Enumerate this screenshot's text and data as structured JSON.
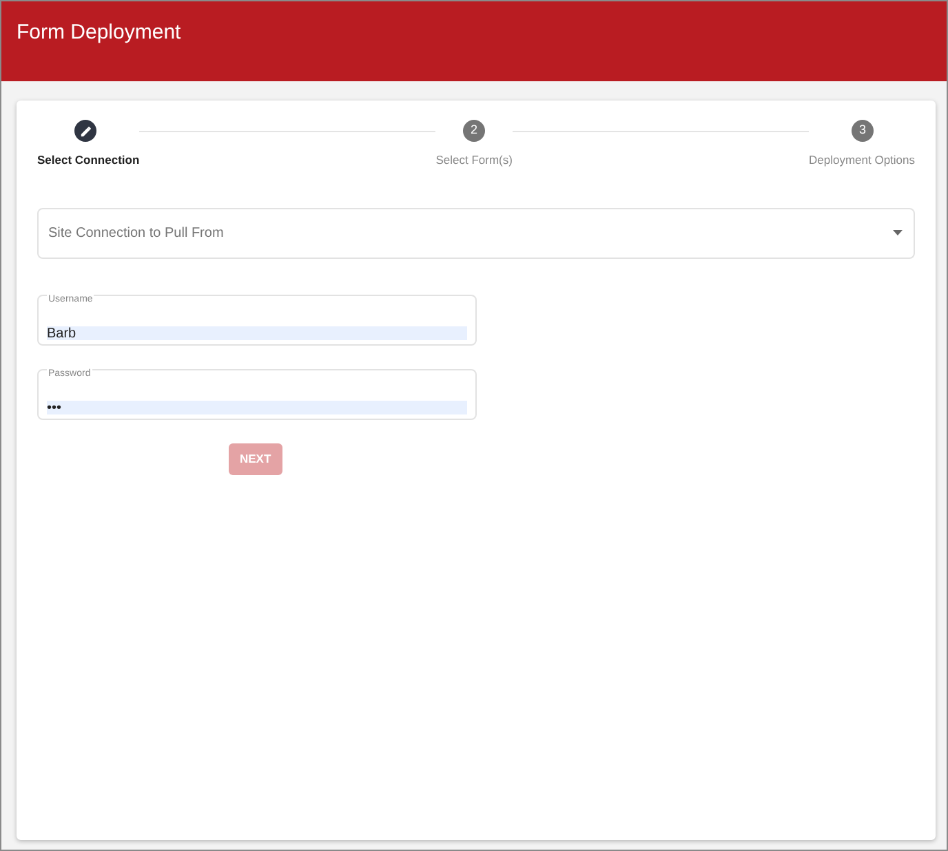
{
  "header": {
    "title": "Form Deployment"
  },
  "steps": [
    {
      "label": "Select Connection",
      "selected": true
    },
    {
      "number": "2",
      "label": "Select Form(s)",
      "selected": false
    },
    {
      "number": "3",
      "label": "Deployment Options",
      "selected": false
    }
  ],
  "connection_select": {
    "placeholder": "Site Connection to Pull From"
  },
  "fields": [
    {
      "label": "Username",
      "value": "Barb"
    },
    {
      "label": "Password",
      "value": "•••"
    }
  ],
  "next_button": {
    "label": "NEXT",
    "disabled": true
  }
}
